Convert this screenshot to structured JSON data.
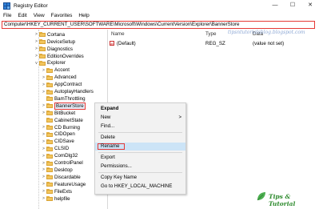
{
  "window": {
    "title": "Registry Editor",
    "controls": [
      "—",
      "☐",
      "✕"
    ]
  },
  "menu": [
    "File",
    "Edit",
    "View",
    "Favorites",
    "Help"
  ],
  "address": "Computer\\HKEY_CURRENT_USER\\SOFTWARE\\Microsoft\\Windows\\CurrentVersion\\Explorer\\BannerStore",
  "tree": {
    "items": [
      {
        "label": "Cortana",
        "expand": ">"
      },
      {
        "label": "DeviceSetup",
        "expand": ">"
      },
      {
        "label": "Diagnostics",
        "expand": ">"
      },
      {
        "label": "EditionOverrides",
        "expand": ">"
      },
      {
        "label": "Explorer",
        "expand": "v"
      },
      {
        "label": "Accent",
        "expand": ">"
      },
      {
        "label": "Advanced",
        "expand": ">"
      },
      {
        "label": "AppContract",
        "expand": ">"
      },
      {
        "label": "AutoplayHandlers",
        "expand": ">"
      },
      {
        "label": "BamThrottling",
        "expand": ""
      },
      {
        "label": "BannerStore",
        "expand": ">"
      },
      {
        "label": "BitBucket",
        "expand": ">"
      },
      {
        "label": "CabinetState",
        "expand": ""
      },
      {
        "label": "CD Burning",
        "expand": ">"
      },
      {
        "label": "CIDOpen",
        "expand": ">"
      },
      {
        "label": "CIDSave",
        "expand": ">"
      },
      {
        "label": "CLSID",
        "expand": ">"
      },
      {
        "label": "ComDlg32",
        "expand": ">"
      },
      {
        "label": "ControlPanel",
        "expand": ">"
      },
      {
        "label": "Desktop",
        "expand": ">"
      },
      {
        "label": "Discardable",
        "expand": ">"
      },
      {
        "label": "FeatureUsage",
        "expand": ">"
      },
      {
        "label": "FileExts",
        "expand": ">"
      },
      {
        "label": "helpfile",
        "expand": ">"
      }
    ]
  },
  "values": {
    "columns": {
      "name": "Name",
      "type": "Type",
      "data": "Data"
    },
    "rows": [
      {
        "icon": "ab",
        "name": "(Default)",
        "type": "REG_SZ",
        "data": "(value not set)"
      }
    ]
  },
  "context_menu": {
    "items": [
      {
        "label": "Expand",
        "bold": true
      },
      {
        "label": "New",
        "arrow": ">"
      },
      {
        "label": "Find..."
      },
      {
        "label": "Delete"
      },
      {
        "label": "Rename"
      },
      {
        "label": "Export"
      },
      {
        "label": "Permissions..."
      },
      {
        "label": "Copy Key Name"
      },
      {
        "label": "Go to HKEY_LOCAL_MACHINE"
      }
    ]
  },
  "watermarks": {
    "top": "tipsntutorialsblog.blogspot.com",
    "bottom": "Tips & Tutorial"
  },
  "colors": {
    "highlight_border": "#e53935",
    "menu_highlight": "#cce4f7",
    "folder": "#f2c55c"
  }
}
